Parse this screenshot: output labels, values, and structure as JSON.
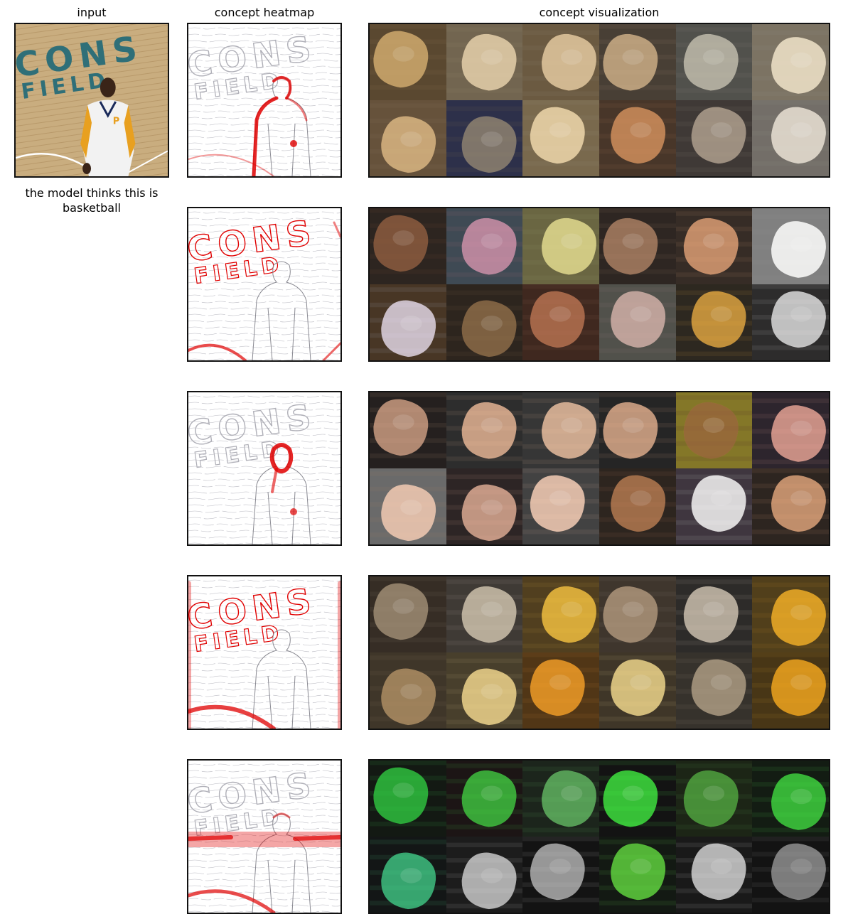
{
  "titles": {
    "input": "input",
    "heatmap": "concept heatmap",
    "visualization": "concept visualization"
  },
  "caption": "the model thinks this is basketball",
  "input_image": {
    "court_text_line1": "CONS",
    "court_text_line2": "FIELD",
    "jersey_letter": "P"
  },
  "colors": {
    "heat": "#e00000",
    "court": "#c9ad7f",
    "court_text": "#2f6f78",
    "dim_overlay": "#1e1e1e"
  },
  "concept_rows": [
    {
      "heat_focus": "person-outline",
      "tiles": [
        {
          "bg": "#8a6b3e",
          "fg": "#c7a36b"
        },
        {
          "bg": "#b79f78",
          "fg": "#d9c6a3"
        },
        {
          "bg": "#a98a5e",
          "fg": "#d8c09a"
        },
        {
          "bg": "#6b5a48",
          "fg": "#c4a882"
        },
        {
          "bg": "#7a7a72",
          "fg": "#b9b4a4"
        },
        {
          "bg": "#c8b89c",
          "fg": "#e3d7c0"
        },
        {
          "bg": "#a07c52",
          "fg": "#cfae7e"
        },
        {
          "bg": "#3a3f6e",
          "fg": "#8c7f6a"
        },
        {
          "bg": "#c4a674",
          "fg": "#e2cda4"
        },
        {
          "bg": "#6a4a32",
          "fg": "#c98b5a"
        },
        {
          "bg": "#5a4f4a",
          "fg": "#a99a8a"
        },
        {
          "bg": "#b8b0a4",
          "fg": "#ddd6ca"
        }
      ]
    },
    {
      "heat_focus": "court-text",
      "tiles": [
        {
          "bg": "#3a2a22",
          "fg": "#8a5a3e"
        },
        {
          "bg": "#5a6e80",
          "fg": "#c88aa0"
        },
        {
          "bg": "#a8a060",
          "fg": "#d7d08a"
        },
        {
          "bg": "#3b2d26",
          "fg": "#a77e62"
        },
        {
          "bg": "#4a382c",
          "fg": "#d69a72"
        },
        {
          "bg": "#cfcfcf",
          "fg": "#f0f0ee"
        },
        {
          "bg": "#6a4a2a",
          "fg": "#d8d0e0"
        },
        {
          "bg": "#3a2a1e",
          "fg": "#8a6a48"
        },
        {
          "bg": "#5a3020",
          "fg": "#b07050"
        },
        {
          "bg": "#7a7a70",
          "fg": "#c9a8a0"
        },
        {
          "bg": "#3a3022",
          "fg": "#d8a040"
        },
        {
          "bg": "#3a3838",
          "fg": "#d8d8d8"
        }
      ]
    },
    {
      "heat_focus": "face",
      "tiles": [
        {
          "bg": "#2a2220",
          "fg": "#c89a80"
        },
        {
          "bg": "#3a3a3a",
          "fg": "#e0b090"
        },
        {
          "bg": "#4a4a4a",
          "fg": "#e3b89a"
        },
        {
          "bg": "#2a2a2a",
          "fg": "#d8a888"
        },
        {
          "bg": "#d8c030",
          "fg": "#8a5a3a"
        },
        {
          "bg": "#3a2a3a",
          "fg": "#e0a090"
        },
        {
          "bg": "#a8a8a8",
          "fg": "#e8c0a8"
        },
        {
          "bg": "#3a2a2a",
          "fg": "#d8a890"
        },
        {
          "bg": "#606060",
          "fg": "#f0c8b0"
        },
        {
          "bg": "#3a2a20",
          "fg": "#b07850"
        },
        {
          "bg": "#5a4a5a",
          "fg": "#f0f0ee"
        },
        {
          "bg": "#3a2a22",
          "fg": "#d8a078"
        }
      ]
    },
    {
      "heat_focus": "edges",
      "tiles": [
        {
          "bg": "#4a3a2a",
          "fg": "#9a8a72"
        },
        {
          "bg": "#5a5048",
          "fg": "#c8bca8"
        },
        {
          "bg": "#7a5a20",
          "fg": "#e8b840"
        },
        {
          "bg": "#5a4a3a",
          "fg": "#a89078"
        },
        {
          "bg": "#3a3632",
          "fg": "#c8bcac"
        },
        {
          "bg": "#7a5a18",
          "fg": "#e8a828"
        },
        {
          "bg": "#5a4a32",
          "fg": "#a88a62"
        },
        {
          "bg": "#6a5a38",
          "fg": "#e8cf8a"
        },
        {
          "bg": "#7a4a10",
          "fg": "#e89828"
        },
        {
          "bg": "#5a4a30",
          "fg": "#e8d088"
        },
        {
          "bg": "#4a4238",
          "fg": "#a89880"
        },
        {
          "bg": "#6a4a10",
          "fg": "#e8a020"
        }
      ]
    },
    {
      "heat_focus": "horizontal-band",
      "tiles": [
        {
          "bg": "#0a140a",
          "fg": "#30c040"
        },
        {
          "bg": "#1a0e0e",
          "fg": "#40c040"
        },
        {
          "bg": "#1a2a1a",
          "fg": "#60b060"
        },
        {
          "bg": "#0a0a0a",
          "fg": "#40e040"
        },
        {
          "bg": "#1a2a10",
          "fg": "#50a040"
        },
        {
          "bg": "#0a1a0a",
          "fg": "#40d040"
        },
        {
          "bg": "#0a1010",
          "fg": "#40c080"
        },
        {
          "bg": "#1a1a1a",
          "fg": "#c8c8c8"
        },
        {
          "bg": "#0a0a0a",
          "fg": "#b0b0b0"
        },
        {
          "bg": "#0a140a",
          "fg": "#60d040"
        },
        {
          "bg": "#141414",
          "fg": "#d0d0d0"
        },
        {
          "bg": "#0a0a0a",
          "fg": "#909090"
        }
      ]
    }
  ]
}
